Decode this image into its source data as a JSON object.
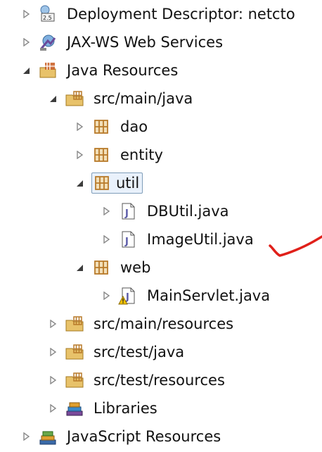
{
  "tree": {
    "items": [
      {
        "label": "Deployment Descriptor: netcto",
        "icon": "deployment-descriptor-icon",
        "expanded": false
      },
      {
        "label": "JAX-WS Web Services",
        "icon": "jaxws-web-services-icon",
        "expanded": false
      },
      {
        "label": "Java Resources",
        "icon": "java-resources-icon",
        "expanded": true
      },
      {
        "label": "src/main/java",
        "icon": "source-folder-icon",
        "expanded": true
      },
      {
        "label": "dao",
        "icon": "package-icon",
        "expanded": false
      },
      {
        "label": "entity",
        "icon": "package-icon",
        "expanded": false
      },
      {
        "label": "util",
        "icon": "package-icon",
        "expanded": true,
        "selected": true
      },
      {
        "label": "DBUtil.java",
        "icon": "java-file-icon",
        "expanded": false
      },
      {
        "label": "ImageUtil.java",
        "icon": "java-file-icon",
        "expanded": false
      },
      {
        "label": "web",
        "icon": "package-icon",
        "expanded": true
      },
      {
        "label": "MainServlet.java",
        "icon": "java-file-warning-icon",
        "expanded": false
      },
      {
        "label": "src/main/resources",
        "icon": "source-folder-icon",
        "expanded": false
      },
      {
        "label": "src/test/java",
        "icon": "source-folder-icon",
        "expanded": false
      },
      {
        "label": "src/test/resources",
        "icon": "source-folder-icon",
        "expanded": false
      },
      {
        "label": "Libraries",
        "icon": "libraries-icon",
        "expanded": false
      },
      {
        "label": "JavaScript Resources",
        "icon": "javascript-resources-icon",
        "expanded": false
      }
    ]
  },
  "colors": {
    "twisty": "#8a8a8a",
    "twisty_expanded": "#3c3c3c",
    "folder": "#e8c26a",
    "package": "#b87a2a",
    "java_file_letter": "#5a5aa8",
    "annotation": "#e0201a"
  }
}
